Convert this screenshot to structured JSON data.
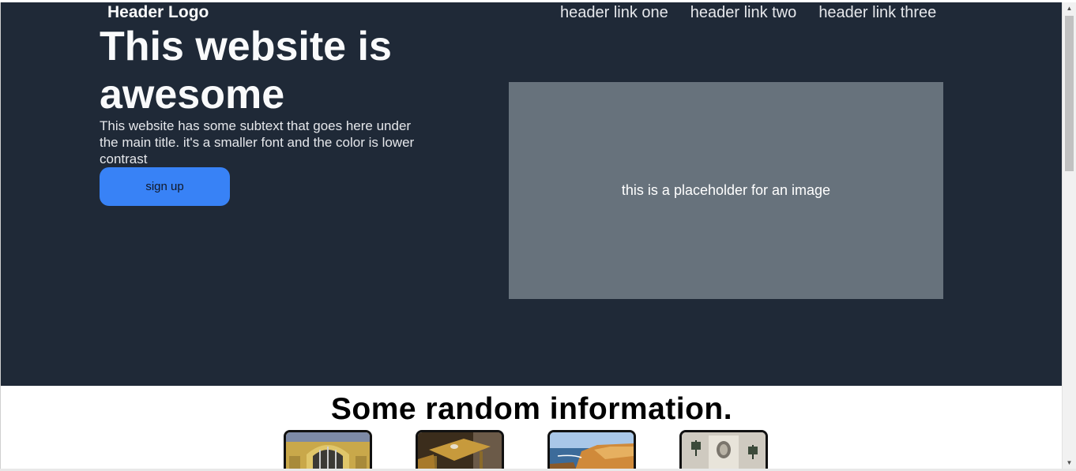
{
  "header": {
    "logo": "Header Logo",
    "links": [
      "header link one",
      "header link two",
      "header link three"
    ]
  },
  "hero": {
    "title": "This website is awesome",
    "subtext": "This website has some subtext that goes here under the main title. it's a smaller font and the color is lower contrast",
    "signup_label": "sign up",
    "image_placeholder": "this is a placeholder for an image"
  },
  "info": {
    "heading": "Some random information.",
    "cards": [
      "building-archway-image",
      "cafe-table-image",
      "coastal-cliffs-image",
      "building-facade-lamps-image"
    ]
  },
  "colors": {
    "hero_bg": "#1f2937",
    "button": "#3882f6",
    "placeholder_bg": "#67727c"
  }
}
